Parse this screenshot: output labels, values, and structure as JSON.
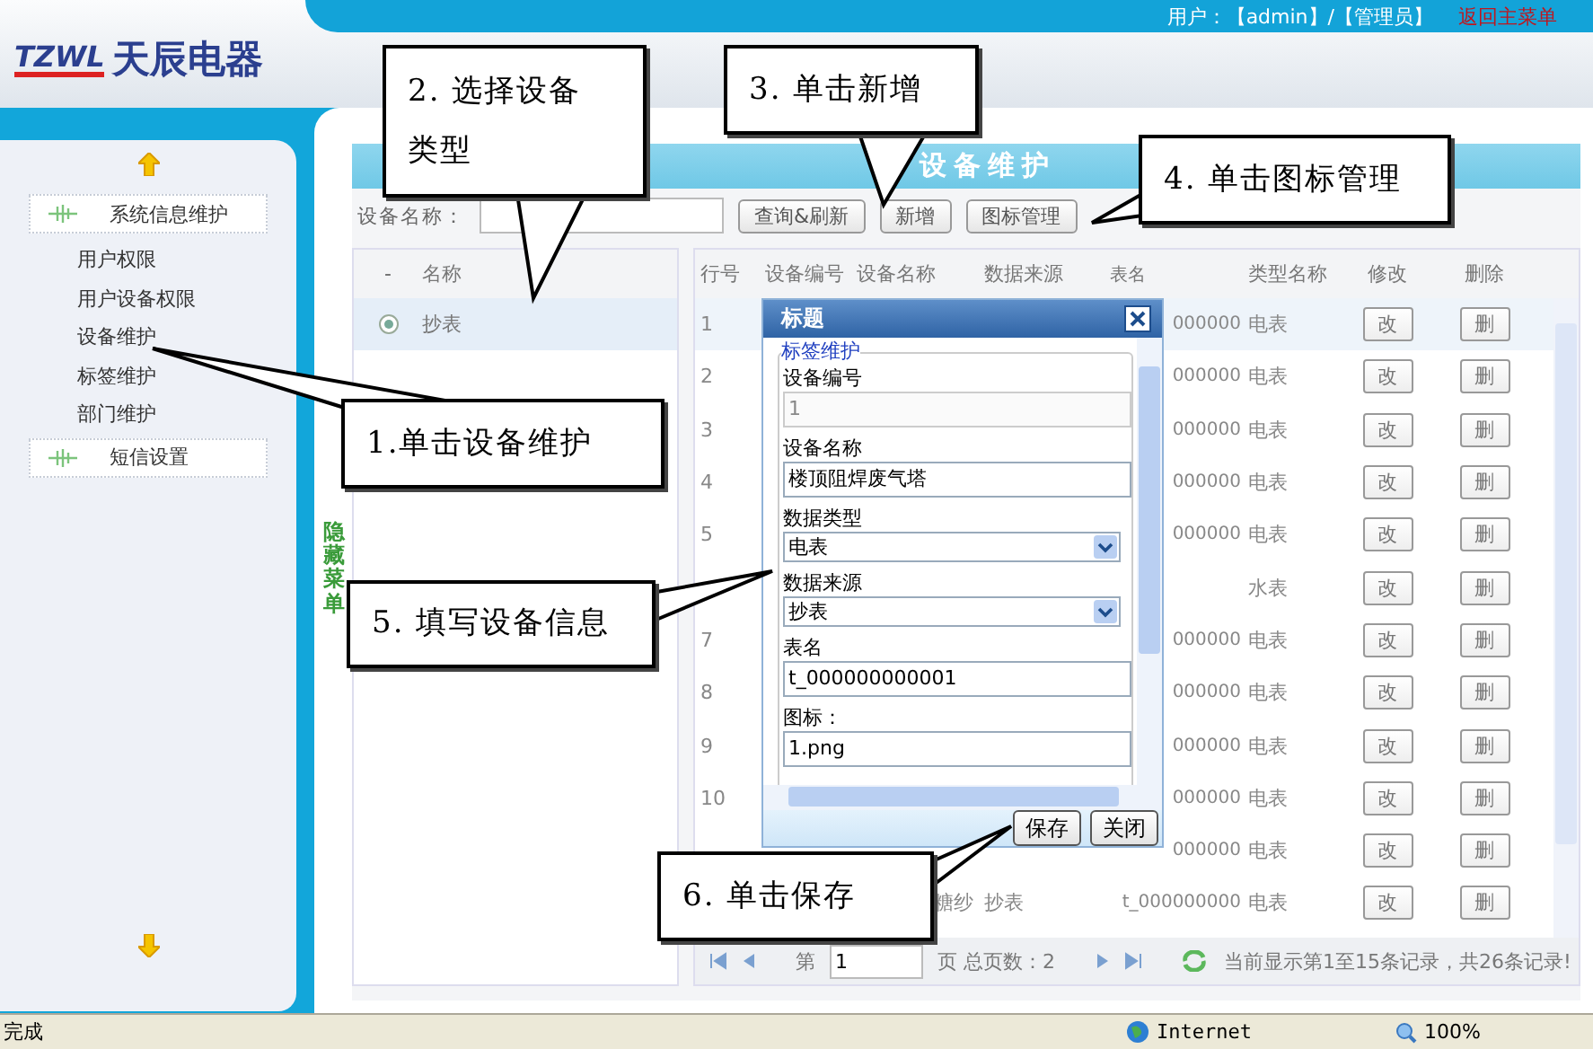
{
  "header": {
    "logo_mark": "TZWL",
    "logo_text": "天辰电器",
    "user_info": "用户：【admin】/【管理员】",
    "return_link": "返回主菜单"
  },
  "sidebar": {
    "items": [
      {
        "label": "系统信息维护",
        "children": [
          {
            "label": "用户权限"
          },
          {
            "label": "用户设备权限"
          },
          {
            "label": "设备维护"
          },
          {
            "label": "标签维护"
          },
          {
            "label": "部门维护"
          }
        ]
      },
      {
        "label": "短信设置"
      }
    ]
  },
  "hide_menu": "隐藏菜单",
  "page_title": "设备维护",
  "search": {
    "label": "设备名称：",
    "buttons": [
      "查询&刷新",
      "新增",
      "图标管理"
    ]
  },
  "type_grid": {
    "columns": [
      "-",
      "名称"
    ],
    "rows": [
      {
        "name": "抄表",
        "selected": true
      }
    ]
  },
  "device_table": {
    "columns": [
      "行号",
      "设备编号",
      "设备名称",
      "数据来源",
      "表名",
      "类型名称",
      "修改",
      "删除"
    ],
    "rows": [
      {
        "row_no": "1",
        "table_name": "000000",
        "type_name": "电表",
        "edit": "改",
        "delete": "删"
      },
      {
        "row_no": "2",
        "table_name": "000000",
        "type_name": "电表",
        "edit": "改",
        "delete": "删"
      },
      {
        "row_no": "3",
        "table_name": "000000",
        "type_name": "电表",
        "edit": "改",
        "delete": "删"
      },
      {
        "row_no": "4",
        "table_name": "000000",
        "type_name": "电表",
        "edit": "改",
        "delete": "删"
      },
      {
        "row_no": "5",
        "table_name": "000000",
        "type_name": "电表",
        "edit": "改",
        "delete": "删"
      },
      {
        "type_name": "水表",
        "edit": "改",
        "delete": "删"
      },
      {
        "row_no": "7",
        "table_name": "000000",
        "type_name": "电表",
        "edit": "改",
        "delete": "删"
      },
      {
        "row_no": "8",
        "table_name": "000000",
        "type_name": "电表",
        "edit": "改",
        "delete": "删"
      },
      {
        "row_no": "9",
        "table_name": "000000",
        "type_name": "电表",
        "edit": "改",
        "delete": "删"
      },
      {
        "row_no": "10",
        "table_name": "000000",
        "type_name": "电表",
        "edit": "改",
        "delete": "删"
      },
      {
        "table_name": "000000",
        "type_name": "电表",
        "edit": "改",
        "delete": "删"
      },
      {
        "device_name": "糖纱",
        "data_source": "抄表",
        "table_name": "t_000000000",
        "type_name": "电表",
        "edit": "改",
        "delete": "删"
      }
    ]
  },
  "pager": {
    "page_prefix": "第",
    "page_value": "1",
    "page_suffix": "页 总页数：2",
    "summary": "当前显示第1至15条记录，共26条记录!"
  },
  "dialog": {
    "title": "标题",
    "legend": "标签维护",
    "fields": [
      {
        "label": "设备编号",
        "kind": "input",
        "value": "1",
        "disabled": true
      },
      {
        "label": "设备名称",
        "kind": "input",
        "value": "楼顶阻焊废气塔",
        "disabled": false
      },
      {
        "label": "数据类型",
        "kind": "select",
        "value": "电表",
        "disabled": false
      },
      {
        "label": "数据来源",
        "kind": "select",
        "value": "抄表",
        "disabled": false
      },
      {
        "label": "表名",
        "kind": "input",
        "value": "t_000000000001",
        "disabled": false
      },
      {
        "label": "图标：",
        "kind": "input",
        "value": "1.png",
        "disabled": false
      }
    ],
    "buttons": [
      "保存",
      "关闭"
    ]
  },
  "callouts": [
    "2. 选择设备类型",
    "3. 单击新增",
    "4. 单击图标管理",
    "1.单击设备维护",
    "5. 填写设备信息",
    "6. 单击保存"
  ],
  "status_bar": {
    "text": "完成",
    "zone": "Internet",
    "zoom": "100%"
  }
}
